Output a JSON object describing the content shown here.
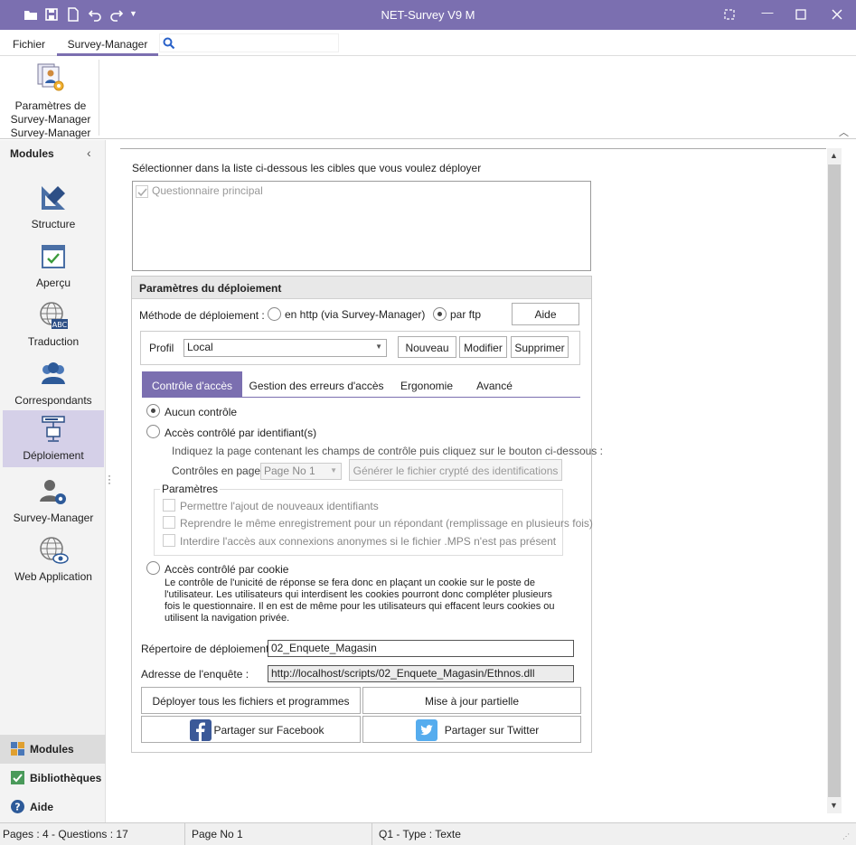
{
  "window": {
    "title": "NET-Survey V9 M"
  },
  "ribbon": {
    "tabs": [
      "Fichier",
      "Survey-Manager"
    ],
    "search_placeholder": "",
    "button": {
      "line1": "Paramètres de",
      "line2": "Survey-Manager",
      "group": "Survey-Manager"
    }
  },
  "sidebar": {
    "header": "Modules",
    "modules": [
      {
        "label": "Structure",
        "icon": "pencil-ruler-icon"
      },
      {
        "label": "Aperçu",
        "icon": "preview-window-icon"
      },
      {
        "label": "Traduction",
        "icon": "globe-abc-icon"
      },
      {
        "label": "Correspondants",
        "icon": "users-icon"
      },
      {
        "label": "Déploiement",
        "icon": "deploy-server-icon"
      },
      {
        "label": "Survey-Manager",
        "icon": "user-gear-icon"
      },
      {
        "label": "Web Application",
        "icon": "globe-eye-icon"
      }
    ],
    "active_module": "Déploiement",
    "bottom": [
      {
        "label": "Modules",
        "icon": "modules-icon"
      },
      {
        "label": "Bibliothèques",
        "icon": "library-icon"
      },
      {
        "label": "Aide",
        "icon": "help-icon"
      }
    ]
  },
  "targets": {
    "instruction": "Sélectionner dans la liste ci-dessous les cibles que vous voulez déployer",
    "items": [
      {
        "label": "Questionnaire principal",
        "checked": true
      }
    ]
  },
  "deploy": {
    "header": "Paramètres du déploiement",
    "method_label": "Méthode de déploiement :",
    "method_http": "en http (via Survey-Manager)",
    "method_ftp": "par ftp",
    "method_selected": "ftp",
    "help_button": "Aide",
    "profile_label": "Profil",
    "profile_value": "Local",
    "btn_new": "Nouveau",
    "btn_edit": "Modifier",
    "btn_delete": "Supprimer",
    "tabs": [
      "Contrôle d'accès",
      "Gestion des erreurs d'accès",
      "Ergonomie",
      "Avancé"
    ],
    "active_tab": "Contrôle d'accès",
    "access": {
      "none": "Aucun contrôle",
      "by_id": "Accès contrôlé par identifiant(s)",
      "by_id_hint": "Indiquez la page contenant les champs de contrôle puis cliquez sur le bouton ci-dessous :",
      "pages_label": "Contrôles en page :",
      "pages_value": "Page No 1",
      "generate_button": "Générer le fichier crypté des identifications",
      "params_title": "Paramètres",
      "params": [
        "Permettre l'ajout de nouveaux identifiants",
        "Reprendre le même enregistrement pour un répondant (remplissage en plusieurs fois)",
        "Interdire l'accès aux connexions anonymes si le fichier .MPS n'est pas présent"
      ],
      "by_cookie": "Accès contrôlé par cookie",
      "cookie_text": [
        "Le contrôle de l'unicité de réponse se fera donc en plaçant un cookie sur le poste de",
        "l'utilisateur. Les utilisateurs qui interdisent les cookies pourront donc compléter plusieurs",
        "fois le questionnaire. Il en est de même pour les utilisateurs qui effacent leurs cookies ou",
        "utilisent la navigation privée."
      ],
      "selected": "none"
    },
    "dir_label": "Répertoire de déploiement :",
    "dir_value": "02_Enquete_Magasin",
    "url_label": "Adresse de l'enquête :",
    "url_value": "http://localhost/scripts/02_Enquete_Magasin/Ethnos.dll",
    "btn_deploy_all": "Déployer tous les fichiers et programmes",
    "btn_partial": "Mise à jour partielle",
    "btn_facebook": "Partager sur Facebook",
    "btn_twitter": "Partager sur Twitter"
  },
  "status": {
    "pages": "Pages : 4 - Questions : 17",
    "page": "Page No 1",
    "question": "Q1 - Type : Texte"
  },
  "colors": {
    "accent": "#7b6fb0",
    "facebook": "#3b5998",
    "twitter": "#55acee"
  }
}
